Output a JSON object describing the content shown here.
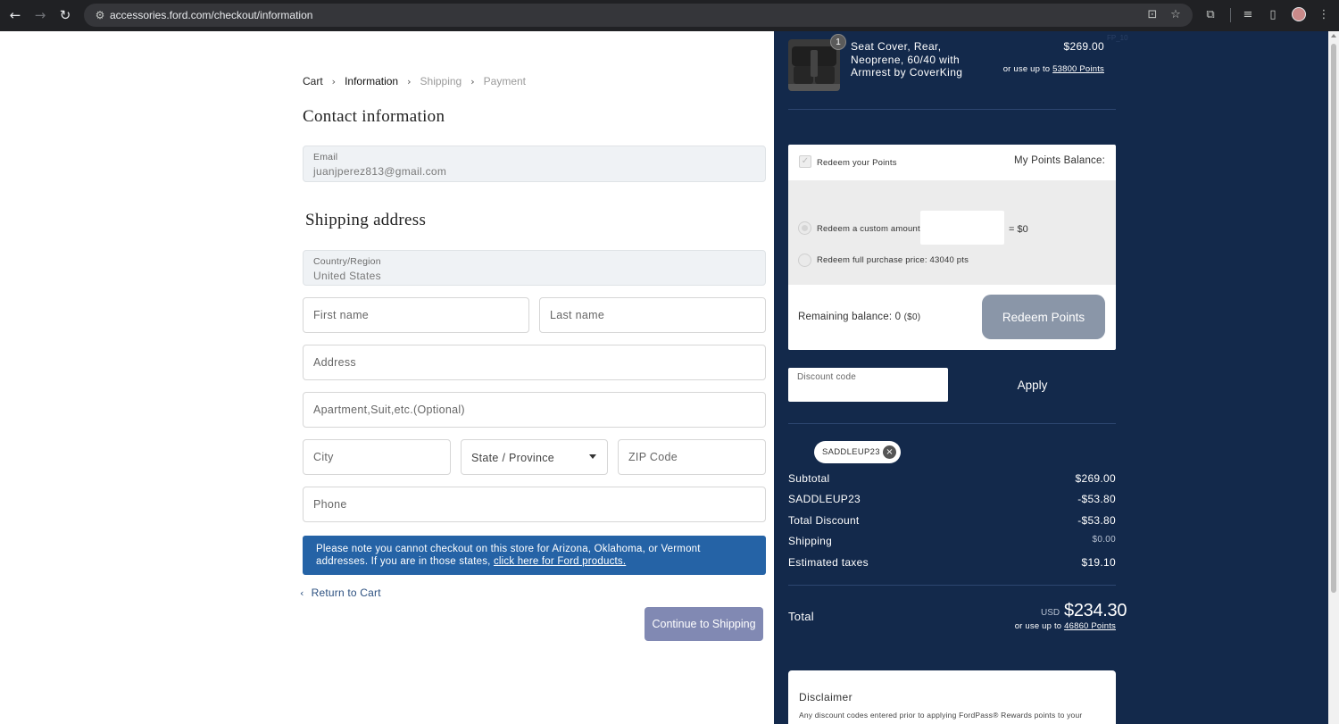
{
  "browser": {
    "url": "accessories.ford.com/checkout/information",
    "icons": [
      "back-icon",
      "forward-icon",
      "reload-icon",
      "tune-icon",
      "install-icon",
      "star-icon",
      "extensions-icon",
      "media-icon",
      "sidepanel-icon",
      "avatar",
      "menu-icon"
    ]
  },
  "breadcrumb": {
    "items": [
      "Cart",
      "Information",
      "Shipping",
      "Payment"
    ]
  },
  "contact": {
    "heading": "Contact information",
    "email_label": "Email",
    "email_value": "juanjperez813@gmail.com"
  },
  "shipping": {
    "heading": "Shipping address",
    "country_label": "Country/Region",
    "country_value": "United States",
    "first_name_placeholder": "First name",
    "last_name_placeholder": "Last name",
    "address_placeholder": "Address",
    "apartment_placeholder": "Apartment,Suit,etc.(Optional)",
    "city_placeholder": "City",
    "state_value": "State / Province",
    "zip_placeholder": "ZIP Code",
    "phone_placeholder": "Phone"
  },
  "notice": {
    "text": "Please note you cannot checkout on this store for Arizona, Oklahoma, or Vermont addresses. If you are in those states, ",
    "link": "click here for Ford products."
  },
  "actions": {
    "return_label": "Return to Cart",
    "continue_label": "Continue to Shipping"
  },
  "summary": {
    "product": {
      "quantity": "1",
      "name": "Seat Cover, Rear, Neoprene, 60/40 with Armrest by CoverKing",
      "price": "$269.00",
      "points_prefix": "or use up to ",
      "points_link": "53800 Points"
    },
    "faint_text": "FP_10",
    "points": {
      "redeem_label": "Redeem your Points",
      "balance_label": "My Points Balance:",
      "custom_label": "Redeem a custom amount",
      "equals": "= $0",
      "full_label": "Redeem full purchase price: 43040 pts",
      "remaining_label": "Remaining balance: 0",
      "remaining_usd": "($0)",
      "redeem_button": "Redeem Points"
    },
    "discount": {
      "placeholder": "Discount code",
      "apply_label": "Apply",
      "applied_code": "SADDLEUP23"
    },
    "rows": [
      {
        "label": "Subtotal",
        "value": "$269.00"
      },
      {
        "label": "SADDLEUP23",
        "value": "-$53.80"
      },
      {
        "label": "Total Discount",
        "value": "-$53.80"
      },
      {
        "label": "Shipping",
        "value": "$0.00"
      },
      {
        "label": "Estimated taxes",
        "value": "$19.10"
      }
    ],
    "total": {
      "label": "Total",
      "currency": "USD",
      "value": "$234.30",
      "points_prefix": "or use up to ",
      "points_link": "46860 Points"
    },
    "disclaimer": {
      "heading": "Disclaimer",
      "text": "Any discount codes entered prior to applying FordPass® Rewards points to your"
    }
  },
  "colors": {
    "panel": "#13294b",
    "notice": "#2563a6",
    "continue_button": "#8189b3",
    "redeem_button": "#8a96a8"
  }
}
